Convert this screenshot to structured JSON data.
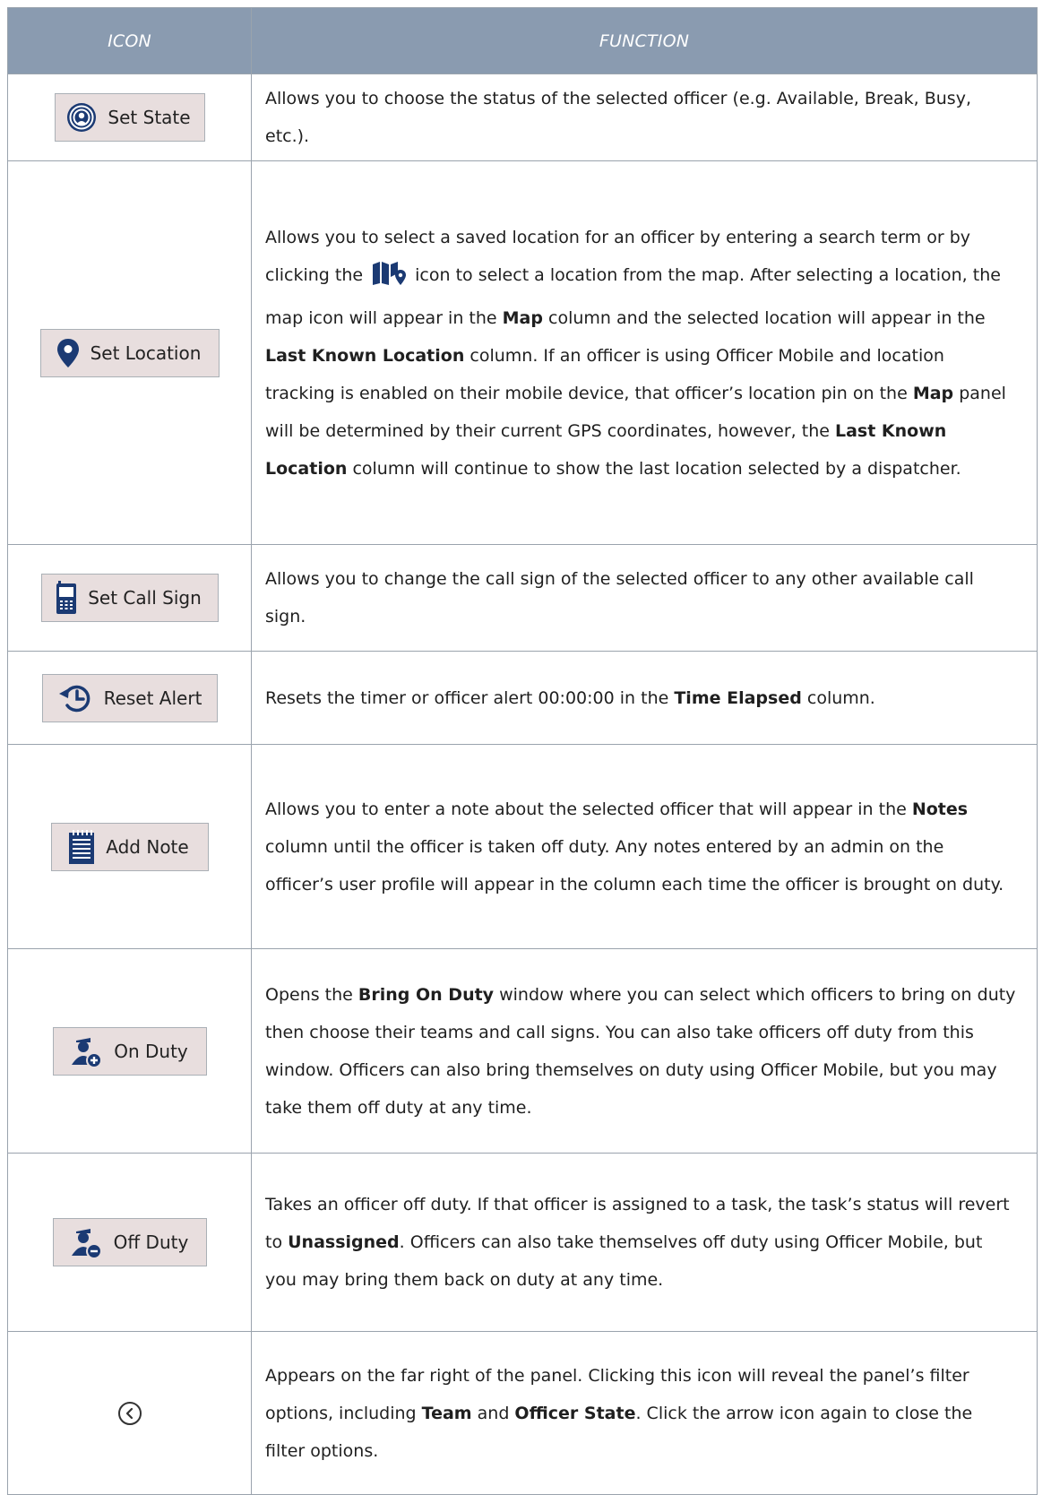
{
  "headers": {
    "icon": "ICON",
    "function": "FUNCTION"
  },
  "rows": [
    {
      "button_label": "Set State",
      "icon": "broadcast-person-icon",
      "desc": [
        {
          "t": "Allows you to choose the status of the selected officer (e.g. Available, Break, Busy, etc.)."
        }
      ]
    },
    {
      "button_label": "Set Location",
      "icon": "location-pin-icon",
      "desc": [
        {
          "t": "Allows you to select a saved location for an officer by entering a search term or by clicking the "
        },
        {
          "icon": "map-icon"
        },
        {
          "t": " icon to select a location from the map. After selecting a location, the map icon will appear in the "
        },
        {
          "t": "Map",
          "b": true
        },
        {
          "t": " column and the selected location will appear in the "
        },
        {
          "t": "Last Known Location",
          "b": true
        },
        {
          "t": " column. If an officer is using Officer Mobile and location tracking is enabled on their mobile device, that officer’s location pin on the "
        },
        {
          "t": "Map",
          "b": true
        },
        {
          "t": " panel will be determined by their current GPS coordinates, however, the "
        },
        {
          "t": "Last Known Location",
          "b": true
        },
        {
          "t": " column will continue to show the last location selected by a dispatcher."
        }
      ]
    },
    {
      "button_label": "Set Call Sign",
      "icon": "phone-icon",
      "desc": [
        {
          "t": "Allows you to change the call sign of the selected officer to any other available call sign."
        }
      ]
    },
    {
      "button_label": "Reset Alert",
      "icon": "reset-clock-icon",
      "desc": [
        {
          "t": "Resets the timer or officer alert 00:00:00 in the "
        },
        {
          "t": "Time Elapsed",
          "b": true
        },
        {
          "t": " column."
        }
      ]
    },
    {
      "button_label": "Add Note",
      "icon": "notepad-icon",
      "desc": [
        {
          "t": "Allows you to enter a note about the selected officer that will appear in the "
        },
        {
          "t": "Notes",
          "b": true
        },
        {
          "t": " column until the officer is taken off duty. Any notes entered by an admin on the officer’s user profile will appear in the column each time the officer is brought on duty."
        }
      ]
    },
    {
      "button_label": "On Duty",
      "icon": "officer-add-icon",
      "desc": [
        {
          "t": "Opens the "
        },
        {
          "t": "Bring On Duty",
          "b": true
        },
        {
          "t": " window where you can select which officers to bring on duty then choose their teams and call signs. You can also take officers off duty from this window. Officers can also bring themselves on duty using Officer Mobile, but you may take them off duty at any time."
        }
      ]
    },
    {
      "button_label": "Off Duty",
      "icon": "officer-remove-icon",
      "desc": [
        {
          "t": "Takes an officer off duty. If that officer is assigned to a task, the task’s status will revert to "
        },
        {
          "t": "Unassigned",
          "b": true
        },
        {
          "t": ". Officers can also take themselves off duty using Officer Mobile, but you may bring them back on duty at any time."
        }
      ]
    },
    {
      "button_label": "",
      "icon": "chevron-left-circle-icon",
      "desc": [
        {
          "t": "Appears on the far right of the panel. Clicking this icon will reveal the panel’s filter options, including "
        },
        {
          "t": "Team",
          "b": true
        },
        {
          "t": " and "
        },
        {
          "t": "Officer State",
          "b": true
        },
        {
          "t": ". Click the arrow icon again to close the filter options."
        }
      ]
    }
  ]
}
